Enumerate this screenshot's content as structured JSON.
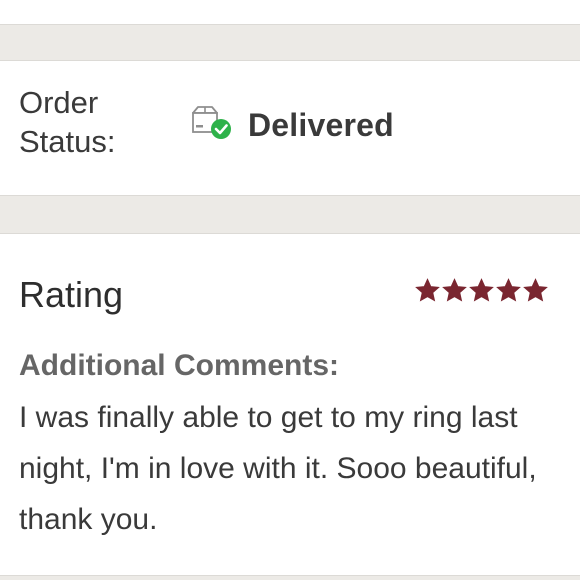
{
  "order_status": {
    "label": "Order Status:",
    "value": "Delivered",
    "icon": "delivered-box-check-icon",
    "check_color": "#2eb24a"
  },
  "review": {
    "rating_label": "Rating",
    "rating_value": 5,
    "rating_max": 5,
    "star_color": "#7a2630",
    "comments_heading": "Additional Comments:",
    "comments_text": "I was finally able to get to my ring last night, I'm in love with it. Sooo beautiful, thank you."
  }
}
